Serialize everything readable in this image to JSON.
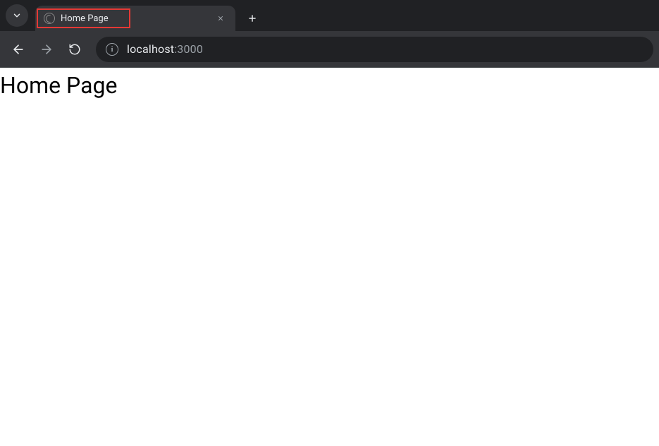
{
  "browser": {
    "tab": {
      "title": "Home Page"
    },
    "url": {
      "host": "localhost",
      "port": ":3000"
    }
  },
  "page": {
    "heading": "Home Page"
  }
}
